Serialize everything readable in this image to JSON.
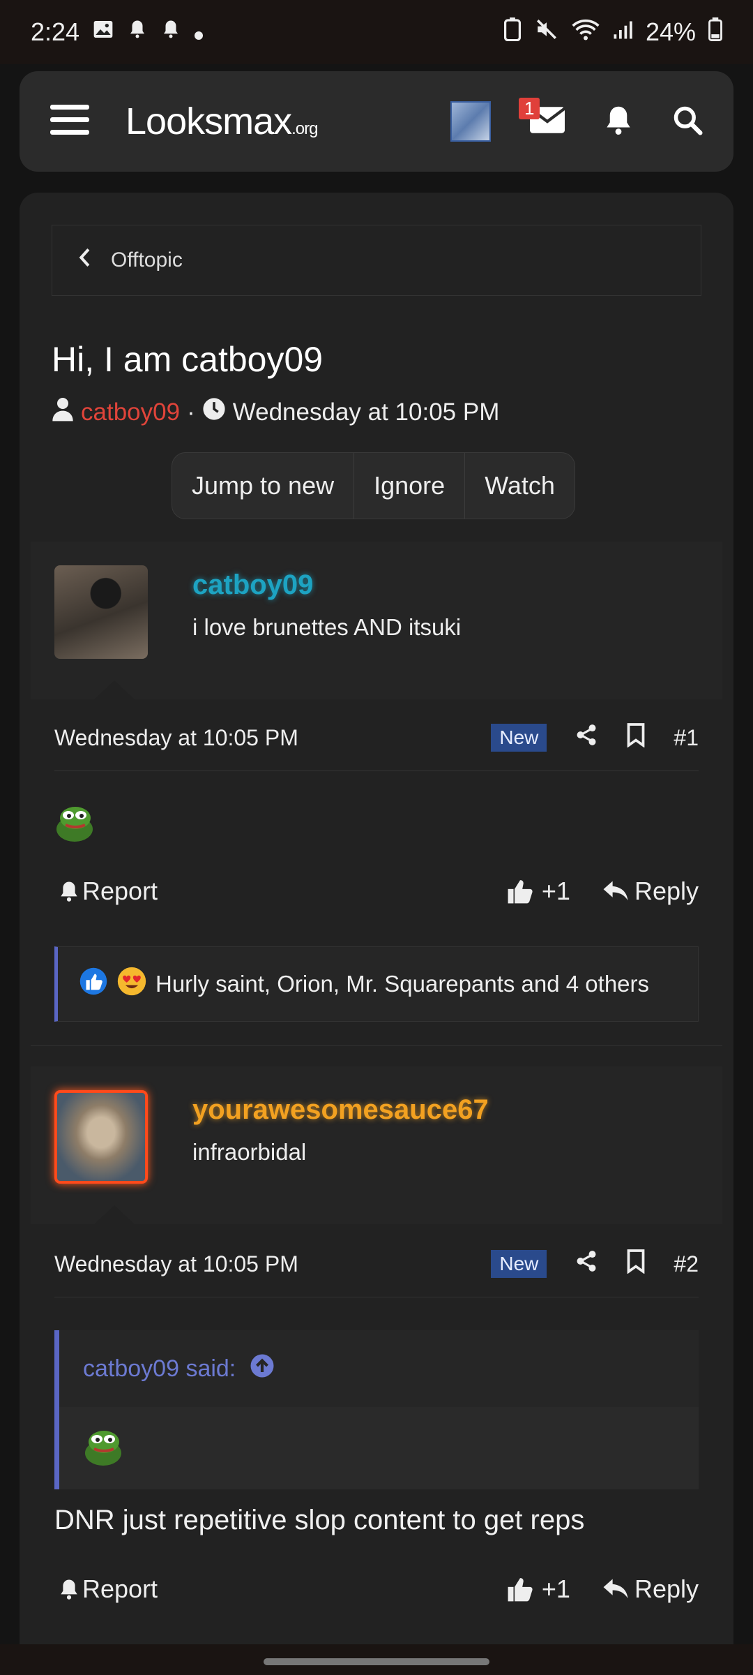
{
  "status": {
    "time": "2:24",
    "battery": "24%"
  },
  "header": {
    "logo_main": "Looksmax",
    "logo_suffix": ".org",
    "inbox_badge": "1"
  },
  "breadcrumb": {
    "label": "Offtopic"
  },
  "thread": {
    "title": "Hi, I am catboy09",
    "author": "catboy09",
    "date": "Wednesday at 10:05 PM",
    "buttons": [
      "Jump to new",
      "Ignore",
      "Watch"
    ]
  },
  "posts": [
    {
      "username": "catboy09",
      "user_title": "i love brunettes AND itsuki",
      "username_color": "#1da3c2",
      "date": "Wednesday at 10:05 PM",
      "new_label": "New",
      "number": "#1",
      "report": "Report",
      "likes": "+1",
      "reply": "Reply",
      "reactions": "Hurly saint, Orion, Mr. Squarepants and 4 others"
    },
    {
      "username": "yourawesomesauce67",
      "user_title": "infraorbidal",
      "username_color": "#f2a121",
      "date": "Wednesday at 10:05 PM",
      "new_label": "New",
      "number": "#2",
      "quote_author": "catboy09 said:",
      "body": "DNR just repetitive slop content to get reps",
      "report": "Report",
      "likes": "+1",
      "reply": "Reply"
    }
  ],
  "colors": {
    "accent": "#5a66c4",
    "new_tag": "#2a4a8c",
    "author_red": "#e0443a"
  }
}
